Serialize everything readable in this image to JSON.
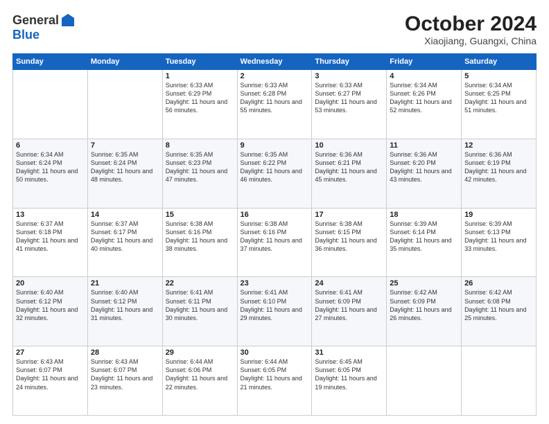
{
  "header": {
    "logo_general": "General",
    "logo_blue": "Blue",
    "title": "October 2024",
    "location": "Xiaojiang, Guangxi, China"
  },
  "columns": [
    "Sunday",
    "Monday",
    "Tuesday",
    "Wednesday",
    "Thursday",
    "Friday",
    "Saturday"
  ],
  "weeks": [
    [
      {
        "day": "",
        "content": ""
      },
      {
        "day": "",
        "content": ""
      },
      {
        "day": "1",
        "content": "Sunrise: 6:33 AM\nSunset: 6:29 PM\nDaylight: 11 hours and 56 minutes."
      },
      {
        "day": "2",
        "content": "Sunrise: 6:33 AM\nSunset: 6:28 PM\nDaylight: 11 hours and 55 minutes."
      },
      {
        "day": "3",
        "content": "Sunrise: 6:33 AM\nSunset: 6:27 PM\nDaylight: 11 hours and 53 minutes."
      },
      {
        "day": "4",
        "content": "Sunrise: 6:34 AM\nSunset: 6:26 PM\nDaylight: 11 hours and 52 minutes."
      },
      {
        "day": "5",
        "content": "Sunrise: 6:34 AM\nSunset: 6:25 PM\nDaylight: 11 hours and 51 minutes."
      }
    ],
    [
      {
        "day": "6",
        "content": "Sunrise: 6:34 AM\nSunset: 6:24 PM\nDaylight: 11 hours and 50 minutes."
      },
      {
        "day": "7",
        "content": "Sunrise: 6:35 AM\nSunset: 6:24 PM\nDaylight: 11 hours and 48 minutes."
      },
      {
        "day": "8",
        "content": "Sunrise: 6:35 AM\nSunset: 6:23 PM\nDaylight: 11 hours and 47 minutes."
      },
      {
        "day": "9",
        "content": "Sunrise: 6:35 AM\nSunset: 6:22 PM\nDaylight: 11 hours and 46 minutes."
      },
      {
        "day": "10",
        "content": "Sunrise: 6:36 AM\nSunset: 6:21 PM\nDaylight: 11 hours and 45 minutes."
      },
      {
        "day": "11",
        "content": "Sunrise: 6:36 AM\nSunset: 6:20 PM\nDaylight: 11 hours and 43 minutes."
      },
      {
        "day": "12",
        "content": "Sunrise: 6:36 AM\nSunset: 6:19 PM\nDaylight: 11 hours and 42 minutes."
      }
    ],
    [
      {
        "day": "13",
        "content": "Sunrise: 6:37 AM\nSunset: 6:18 PM\nDaylight: 11 hours and 41 minutes."
      },
      {
        "day": "14",
        "content": "Sunrise: 6:37 AM\nSunset: 6:17 PM\nDaylight: 11 hours and 40 minutes."
      },
      {
        "day": "15",
        "content": "Sunrise: 6:38 AM\nSunset: 6:16 PM\nDaylight: 11 hours and 38 minutes."
      },
      {
        "day": "16",
        "content": "Sunrise: 6:38 AM\nSunset: 6:16 PM\nDaylight: 11 hours and 37 minutes."
      },
      {
        "day": "17",
        "content": "Sunrise: 6:38 AM\nSunset: 6:15 PM\nDaylight: 11 hours and 36 minutes."
      },
      {
        "day": "18",
        "content": "Sunrise: 6:39 AM\nSunset: 6:14 PM\nDaylight: 11 hours and 35 minutes."
      },
      {
        "day": "19",
        "content": "Sunrise: 6:39 AM\nSunset: 6:13 PM\nDaylight: 11 hours and 33 minutes."
      }
    ],
    [
      {
        "day": "20",
        "content": "Sunrise: 6:40 AM\nSunset: 6:12 PM\nDaylight: 11 hours and 32 minutes."
      },
      {
        "day": "21",
        "content": "Sunrise: 6:40 AM\nSunset: 6:12 PM\nDaylight: 11 hours and 31 minutes."
      },
      {
        "day": "22",
        "content": "Sunrise: 6:41 AM\nSunset: 6:11 PM\nDaylight: 11 hours and 30 minutes."
      },
      {
        "day": "23",
        "content": "Sunrise: 6:41 AM\nSunset: 6:10 PM\nDaylight: 11 hours and 29 minutes."
      },
      {
        "day": "24",
        "content": "Sunrise: 6:41 AM\nSunset: 6:09 PM\nDaylight: 11 hours and 27 minutes."
      },
      {
        "day": "25",
        "content": "Sunrise: 6:42 AM\nSunset: 6:09 PM\nDaylight: 11 hours and 26 minutes."
      },
      {
        "day": "26",
        "content": "Sunrise: 6:42 AM\nSunset: 6:08 PM\nDaylight: 11 hours and 25 minutes."
      }
    ],
    [
      {
        "day": "27",
        "content": "Sunrise: 6:43 AM\nSunset: 6:07 PM\nDaylight: 11 hours and 24 minutes."
      },
      {
        "day": "28",
        "content": "Sunrise: 6:43 AM\nSunset: 6:07 PM\nDaylight: 11 hours and 23 minutes."
      },
      {
        "day": "29",
        "content": "Sunrise: 6:44 AM\nSunset: 6:06 PM\nDaylight: 11 hours and 22 minutes."
      },
      {
        "day": "30",
        "content": "Sunrise: 6:44 AM\nSunset: 6:05 PM\nDaylight: 11 hours and 21 minutes."
      },
      {
        "day": "31",
        "content": "Sunrise: 6:45 AM\nSunset: 6:05 PM\nDaylight: 11 hours and 19 minutes."
      },
      {
        "day": "",
        "content": ""
      },
      {
        "day": "",
        "content": ""
      }
    ]
  ]
}
